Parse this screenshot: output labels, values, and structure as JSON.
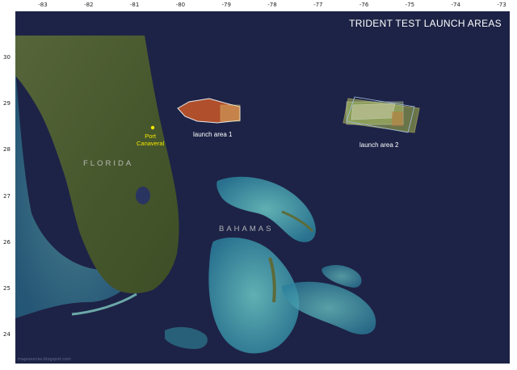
{
  "title": "TRIDENT TEST LAUNCH AREAS",
  "axes": {
    "longitude_labels": [
      "-83",
      "-82",
      "-81",
      "-80",
      "-79",
      "-78",
      "-77",
      "-76",
      "-75",
      "-74",
      "-73"
    ],
    "latitude_labels": [
      "30",
      "29",
      "28",
      "27",
      "26",
      "25",
      "24"
    ],
    "longitude_values": [
      -83,
      -82,
      -81,
      -80,
      -79,
      -78,
      -77,
      -76,
      -75,
      -74,
      -73
    ],
    "latitude_values": [
      30,
      29,
      28,
      27,
      26,
      25,
      24
    ]
  },
  "labels": {
    "launch_area_1": "launch area 1",
    "launch_area_2": "launch area 2",
    "port_line1": "Port",
    "port_line2": "Canaveral",
    "florida": "FLORIDA",
    "bahamas": "BAHAMAS"
  },
  "points": {
    "port_canaveral": {
      "lon": -80.6,
      "lat": 28.4
    }
  },
  "colors": {
    "ocean": "#1d2346",
    "land_green": "#4a5a30",
    "shallow_water": "#3aa8b8",
    "launch_area_1_fill": "#c0542a",
    "launch_area_2_fill": "#a8b84a",
    "port_marker": "#f2e600",
    "title_text": "#ffffff"
  },
  "credit_text": "mapsources.blogspot.com"
}
